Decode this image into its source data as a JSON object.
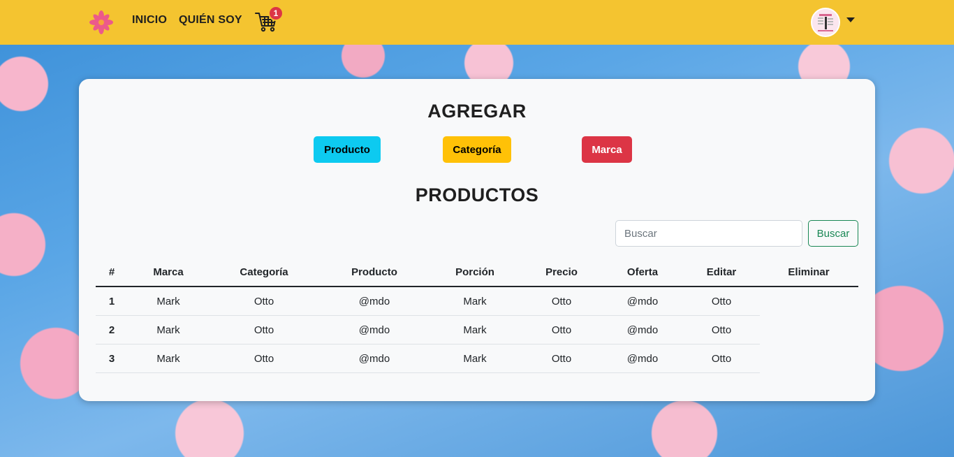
{
  "navbar": {
    "logo_icon": "flower-logo-icon",
    "links": [
      {
        "label": "INICIO"
      },
      {
        "label": "QUIÉN SOY"
      }
    ],
    "cart": {
      "icon": "cart-icon",
      "count": "1"
    },
    "avatar": {
      "icon": "avatar-image"
    },
    "dropdown_icon": "caret-down-icon"
  },
  "agregar": {
    "title": "AGREGAR",
    "buttons": [
      {
        "label": "Producto",
        "color": "#0dcaf0"
      },
      {
        "label": "Categoría",
        "color": "#ffc107"
      },
      {
        "label": "Marca",
        "color": "#dc3545"
      }
    ]
  },
  "productos": {
    "title": "PRODUCTOS",
    "search": {
      "placeholder": "Buscar",
      "button_label": "Buscar"
    },
    "table": {
      "headers": [
        "#",
        "Marca",
        "Categoría",
        "Producto",
        "Porción",
        "Precio",
        "Oferta",
        "Editar",
        "Eliminar"
      ],
      "rows": [
        [
          "1",
          "Mark",
          "Otto",
          "@mdo",
          "Mark",
          "Otto",
          "@mdo",
          "Otto"
        ],
        [
          "2",
          "Mark",
          "Otto",
          "@mdo",
          "Mark",
          "Otto",
          "@mdo",
          "Otto"
        ],
        [
          "3",
          "Mark",
          "Otto",
          "@mdo",
          "Mark",
          "Otto",
          "@mdo",
          "Otto"
        ]
      ]
    }
  },
  "colors": {
    "navbar": "#f4c430",
    "success": "#198754",
    "danger": "#dc3545",
    "info": "#0dcaf0",
    "warning": "#ffc107"
  }
}
